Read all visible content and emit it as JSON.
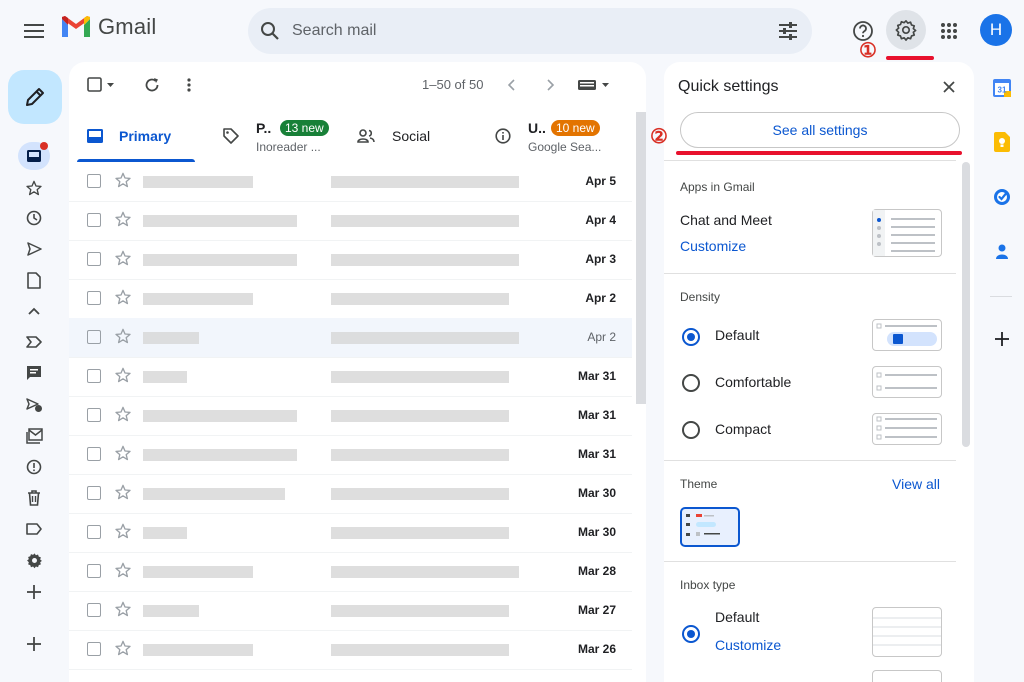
{
  "header": {
    "logo_text": "Gmail",
    "search_placeholder": "Search mail"
  },
  "account": {
    "avatar_letter": "H"
  },
  "annotations": {
    "marker1": "①",
    "marker2": "②"
  },
  "toolbar": {
    "pagination": "1–50 of 50"
  },
  "tabs": [
    {
      "label": "Primary"
    },
    {
      "label": "P..",
      "badge": "13 new",
      "sub": "Inoreader ..."
    },
    {
      "label": "Social"
    },
    {
      "label": "U..",
      "badge": "10 new",
      "sub": "Google Sea..."
    }
  ],
  "emails": [
    {
      "date": "Apr 5",
      "unread": true
    },
    {
      "date": "Apr 4",
      "unread": true
    },
    {
      "date": "Apr 3",
      "unread": true
    },
    {
      "date": "Apr 2",
      "unread": true
    },
    {
      "date": "Apr 2",
      "unread": false
    },
    {
      "date": "Mar 31",
      "unread": true
    },
    {
      "date": "Mar 31",
      "unread": true
    },
    {
      "date": "Mar 31",
      "unread": true
    },
    {
      "date": "Mar 30",
      "unread": true
    },
    {
      "date": "Mar 30",
      "unread": true
    },
    {
      "date": "Mar 28",
      "unread": true
    },
    {
      "date": "Mar 27",
      "unread": true
    },
    {
      "date": "Mar 26",
      "unread": true
    }
  ],
  "quick_settings": {
    "title": "Quick settings",
    "see_all": "See all settings",
    "apps_heading": "Apps in Gmail",
    "chat_meet": "Chat and Meet",
    "customize": "Customize",
    "density_heading": "Density",
    "density_options": [
      "Default",
      "Comfortable",
      "Compact"
    ],
    "theme_heading": "Theme",
    "view_all": "View all",
    "inbox_heading": "Inbox type",
    "inbox_default": "Default",
    "inbox_customize": "Customize"
  },
  "colors": {
    "accent": "#0b57d0",
    "compose_bg": "#c2e7ff",
    "marker_red": "#e8112d",
    "badge_green": "#188038",
    "badge_orange": "#e37400",
    "avatar_bg": "#1a73e8"
  }
}
